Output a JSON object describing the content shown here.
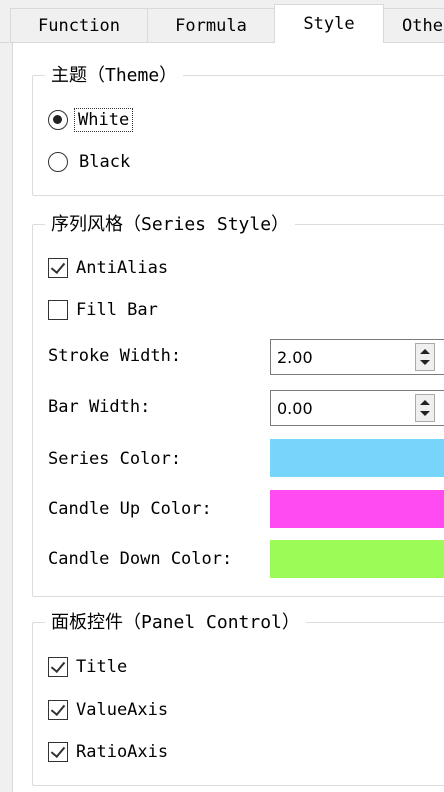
{
  "tabs": [
    "Function",
    "Formula",
    "Style",
    "Othe"
  ],
  "theme": {
    "legend": "主题（Theme）",
    "options": [
      "White",
      "Black"
    ],
    "selected": "White"
  },
  "series_style": {
    "legend": "序列风格（Series Style）",
    "antialias_label": "AntiAlias",
    "antialias_checked": true,
    "fillbar_label": "Fill Bar",
    "fillbar_checked": false,
    "stroke_width_label": "Stroke Width:",
    "stroke_width_value": "2.00",
    "bar_width_label": "Bar Width:",
    "bar_width_value": "0.00",
    "series_color_label": "Series Color:",
    "series_color": "#77d4fb",
    "candle_up_label": "Candle Up Color:",
    "candle_up_color": "#ff4cf2",
    "candle_down_label": "Candle Down Color:",
    "candle_down_color": "#9cfb57"
  },
  "panel_control": {
    "legend": "面板控件（Panel Control）",
    "items": [
      {
        "label": "Title",
        "checked": true
      },
      {
        "label": "ValueAxis",
        "checked": true
      },
      {
        "label": "RatioAxis",
        "checked": true
      }
    ]
  }
}
